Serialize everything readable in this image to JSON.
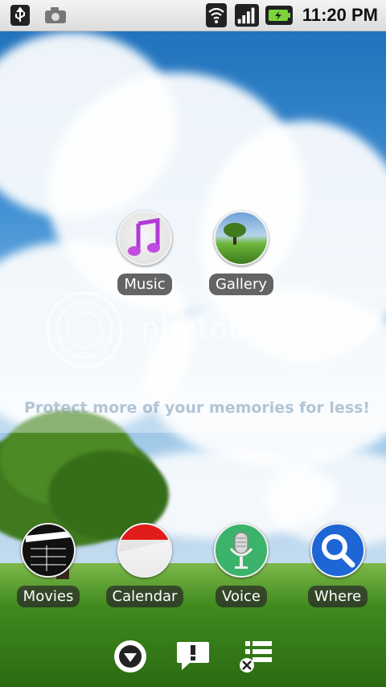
{
  "status_bar": {
    "time": "11:20 PM",
    "left_icons": [
      "usb-icon",
      "camera-icon"
    ],
    "right_icons": [
      "wifi-icon",
      "signal-icon",
      "battery-charging-icon"
    ]
  },
  "watermark": {
    "brand": "photobucket",
    "tagline": "Protect more of your memories for less!"
  },
  "home_apps": [
    {
      "label": "Music",
      "icon": "music-icon"
    },
    {
      "label": "Gallery",
      "icon": "gallery-icon"
    },
    {
      "label": "Movies",
      "icon": "movies-icon"
    },
    {
      "label": "Calendar",
      "icon": "calendar-icon"
    },
    {
      "label": "Voice",
      "icon": "microphone-icon"
    },
    {
      "label": "Where",
      "icon": "search-icon"
    }
  ],
  "dock": [
    {
      "icon": "app-drawer-icon"
    },
    {
      "icon": "notification-icon"
    },
    {
      "icon": "settings-list-icon"
    }
  ],
  "colors": {
    "calendar_red": "#e21b1b",
    "voice_green": "#3bb36a",
    "where_blue": "#1e66d6"
  }
}
